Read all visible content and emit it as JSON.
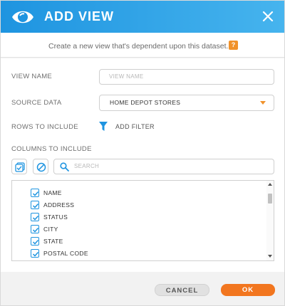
{
  "header": {
    "title": "ADD VIEW",
    "logo_icon": "eye-icon",
    "close_icon": "close-icon",
    "gradient_start": "#1e94e0",
    "gradient_end": "#46b4ee"
  },
  "subtitle": {
    "text": "Create a new view that's dependent upon this dataset.",
    "help_label": "?"
  },
  "form": {
    "view_name_label": "VIEW NAME",
    "view_name_placeholder": "VIEW NAME",
    "view_name_value": "",
    "source_data_label": "SOURCE DATA",
    "source_data_value": "HOME DEPOT STORES",
    "rows_label": "ROWS TO INCLUDE",
    "add_filter_label": "ADD FILTER",
    "columns_label": "COLUMNS TO INCLUDE",
    "search_placeholder": "SEARCH",
    "columns": [
      {
        "name": "NAME",
        "checked": true
      },
      {
        "name": "ADDRESS",
        "checked": true
      },
      {
        "name": "STATUS",
        "checked": true
      },
      {
        "name": "CITY",
        "checked": true
      },
      {
        "name": "STATE",
        "checked": true
      },
      {
        "name": "POSTAL CODE",
        "checked": true
      }
    ]
  },
  "footer": {
    "cancel_label": "CANCEL",
    "ok_label": "OK",
    "accent_color": "#f2761f"
  }
}
